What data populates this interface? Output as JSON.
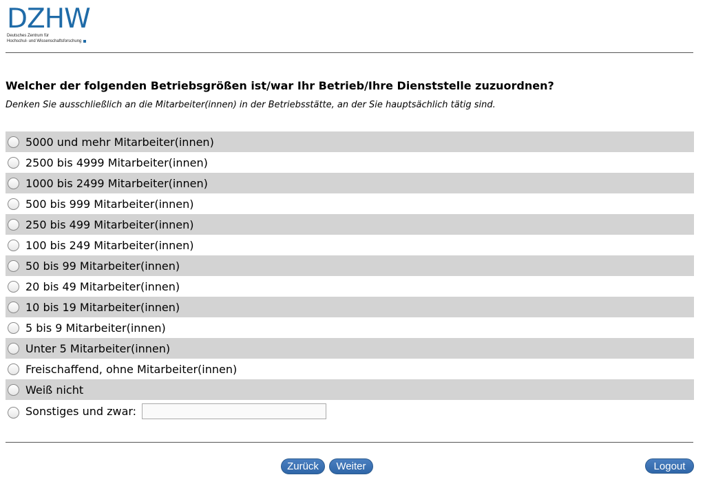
{
  "logo": {
    "wordmark": "DZHW",
    "line1": "Deutsches Zentrum für",
    "line2": "Hochschul- und Wissenschaftsforschung",
    "color": "#1f6ba8"
  },
  "question": {
    "text": "Welcher der folgenden Betriebsgrößen ist/war Ihr Betrieb/Ihre Dienststelle zuzuordnen?",
    "hint": "Denken Sie ausschließlich an die Mitarbeiter(innen) in der Betriebsstätte, an der Sie hauptsächlich tätig sind."
  },
  "options": [
    {
      "label": "5000 und mehr Mitarbeiter(innen)"
    },
    {
      "label": "2500 bis 4999 Mitarbeiter(innen)"
    },
    {
      "label": "1000 bis 2499 Mitarbeiter(innen)"
    },
    {
      "label": "500 bis 999 Mitarbeiter(innen)"
    },
    {
      "label": "250 bis 499 Mitarbeiter(innen)"
    },
    {
      "label": "100 bis 249 Mitarbeiter(innen)"
    },
    {
      "label": "50 bis 99 Mitarbeiter(innen)"
    },
    {
      "label": "20 bis 49 Mitarbeiter(innen)"
    },
    {
      "label": "10 bis 19 Mitarbeiter(innen)"
    },
    {
      "label": "5 bis 9 Mitarbeiter(innen)"
    },
    {
      "label": "Unter 5 Mitarbeiter(innen)"
    },
    {
      "label": "Freischaffend, ohne Mitarbeiter(innen)"
    },
    {
      "label": "Weiß nicht"
    },
    {
      "label": "Sonstiges und zwar:",
      "input_value": ""
    }
  ],
  "nav": {
    "back_label": "Zurück",
    "next_label": "Weiter",
    "logout_label": "Logout"
  },
  "colors": {
    "row_shade": "#d3d3d3",
    "button": "#3a72b4"
  }
}
